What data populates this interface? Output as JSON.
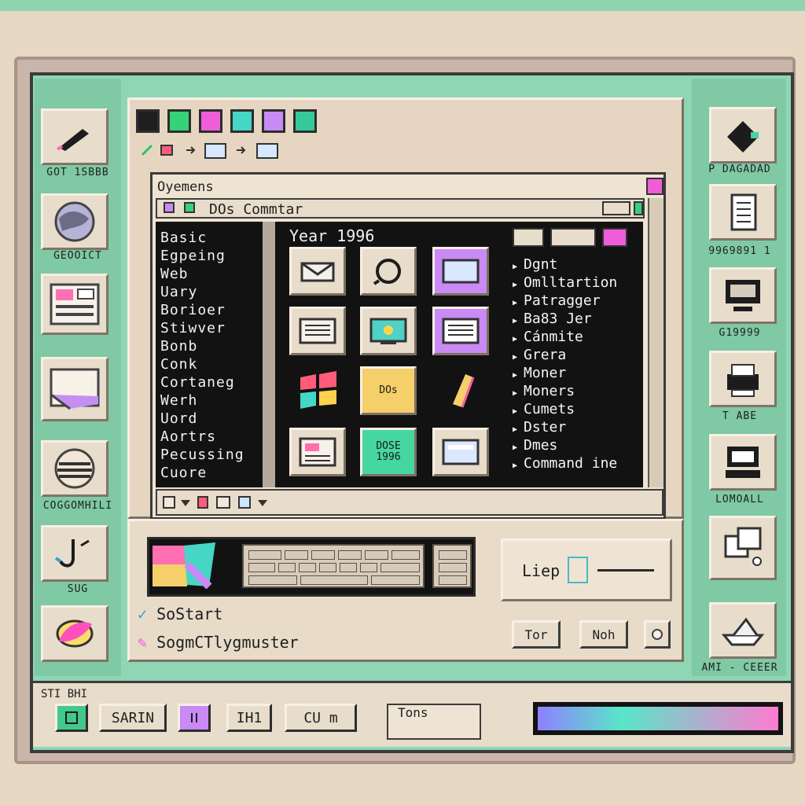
{
  "left_sidebar": {
    "items": [
      {
        "caption": "GOT 1SBBB",
        "icon": "pen-icon"
      },
      {
        "caption": "GEOOICT",
        "icon": "globe-icon"
      },
      {
        "caption": "",
        "icon": "document-icon"
      },
      {
        "caption": "",
        "icon": "folder-paper-icon"
      },
      {
        "caption": "COGGOMHILI",
        "icon": "striped-sphere-icon"
      },
      {
        "caption": "SUG",
        "icon": "anchor-icon"
      },
      {
        "caption": "",
        "icon": "leaf-icon"
      }
    ]
  },
  "right_sidebar": {
    "items": [
      {
        "caption": "P DAGADAD",
        "icon": "drive-icon"
      },
      {
        "caption": "9969891 1",
        "icon": "notepad-icon"
      },
      {
        "caption": "G19999",
        "icon": "monitor-icon"
      },
      {
        "caption": "T ABE",
        "icon": "printer-icon"
      },
      {
        "caption": "LOMOALL",
        "icon": "computer-icon"
      },
      {
        "caption": "",
        "icon": "windows-overlap-icon"
      },
      {
        "caption": "AMI - CEEER",
        "icon": "ship-icon"
      }
    ]
  },
  "toolbar": {
    "color_buttons": [
      "#1f1f1f",
      "#36d27a",
      "#ef5dd9",
      "#46d6c6",
      "#c98af5",
      "#36c89a"
    ]
  },
  "inner_window": {
    "title": "Oyemens",
    "dos_bar_title": "DOs Commtar",
    "menu": [
      "Basic",
      "Egpeing",
      "Web",
      "Uary",
      "Borioer",
      "Stiwver",
      "Bonb",
      "Conk",
      "Cortaneg",
      "Werh",
      "Uord",
      "Aortrs",
      "Pecussing",
      "Cuore"
    ],
    "year_label": "Year 1996",
    "tiles": [
      {
        "label": "",
        "icon": "envelope-icon"
      },
      {
        "label": "",
        "icon": "loop-icon"
      },
      {
        "label": "",
        "icon": "window-icon"
      },
      {
        "label": "",
        "icon": "lines-icon"
      },
      {
        "label": "",
        "icon": "screen-icon"
      },
      {
        "label": "",
        "icon": "notepad-icon"
      },
      {
        "label": "",
        "icon": "windows-logo-icon"
      },
      {
        "label": "DOs",
        "icon": "dos-icon"
      },
      {
        "label": "",
        "icon": "file-icon"
      },
      {
        "label": "",
        "icon": "spreadsheet-icon"
      },
      {
        "label": "DOSE\n1996",
        "icon": "dos-badge-icon"
      },
      {
        "label": "",
        "icon": "terminal-icon"
      }
    ],
    "right_list": [
      "Dgnt",
      "Omlltartion",
      "Patragger",
      "Ba83 Jer",
      "Cánmite",
      "Grera",
      "Moner",
      "Moners",
      "Cumets",
      "Dster",
      "Dmes",
      "Command ine"
    ]
  },
  "controls": {
    "input_label": "Liep",
    "buttons": [
      "Tor",
      "Noh"
    ],
    "start_rows": [
      "SoStart",
      "SogmCTlygmuster"
    ]
  },
  "taskbar": {
    "label": "STI BHI",
    "buttons": [
      "SARIN",
      "IH1",
      "CU m"
    ],
    "field_label": "Tons"
  },
  "colors": {
    "screen_teal": "#8fd6b4",
    "window_beige": "#e6d6c1",
    "dark": "#121212"
  }
}
